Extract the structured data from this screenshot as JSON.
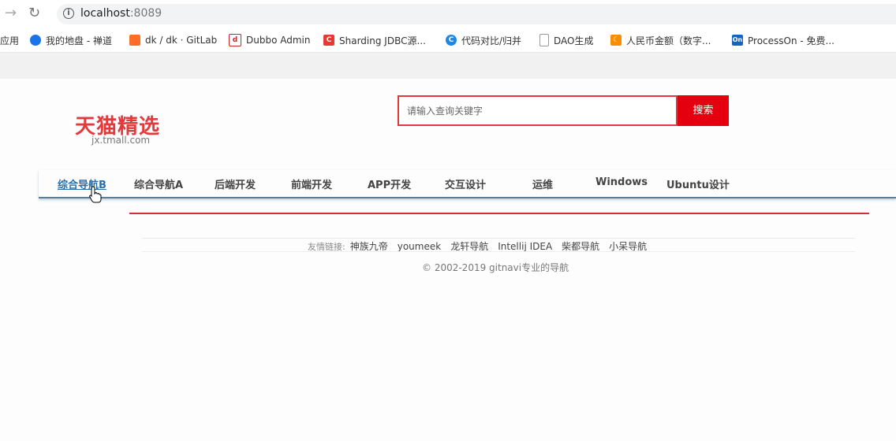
{
  "browser": {
    "url_host": "localhost",
    "url_port": ":8089",
    "bookmarks": [
      {
        "label": "应用",
        "icon": "apps-icon",
        "color": "#4285f4"
      },
      {
        "label": "我的地盘 - 禅道",
        "icon": "globe-icon",
        "color": "#1a73e8"
      },
      {
        "label": "dk / dk · GitLab",
        "icon": "gitlab-icon",
        "color": "#fc6d26"
      },
      {
        "label": "Dubbo Admin",
        "icon": "dubbo-icon",
        "color": "#c62828"
      },
      {
        "label": "Sharding JDBC源...",
        "icon": "sharding-icon",
        "color": "#e53935"
      },
      {
        "label": "代码对比/归并",
        "icon": "compare-icon",
        "color": "#1e88e5"
      },
      {
        "label": "DAO生成",
        "icon": "page-icon",
        "color": "#999999"
      },
      {
        "label": "人民币金额（数字...",
        "icon": "moon-icon",
        "color": "#fb8c00"
      },
      {
        "label": "ProcessOn - 免费...",
        "icon": "processon-icon",
        "color": "#1565c0"
      }
    ]
  },
  "logo": {
    "main": "天猫精选",
    "sub": "jx.tmall.com"
  },
  "search": {
    "placeholder": "请输入查询关键字",
    "button": "搜索"
  },
  "nav": {
    "items": [
      "综合导航B",
      "综合导航A",
      "后端开发",
      "前端开发",
      "APP开发",
      "交互设计",
      "运维",
      "Windows",
      "Ubuntu设计"
    ],
    "active_index": 0
  },
  "footer": {
    "friends_label": "友情链接:",
    "links": [
      "神族九帝",
      "youmeek",
      "龙轩导航",
      "Intellij IDEA",
      "柴都导航",
      "小呆导航"
    ],
    "copyright": "© 2002-2019 gitnavi专业的导航"
  },
  "colors": {
    "accent": "#e4393c",
    "nav_active": "#2a6ea8",
    "nav_underline": "#5a7e97"
  }
}
